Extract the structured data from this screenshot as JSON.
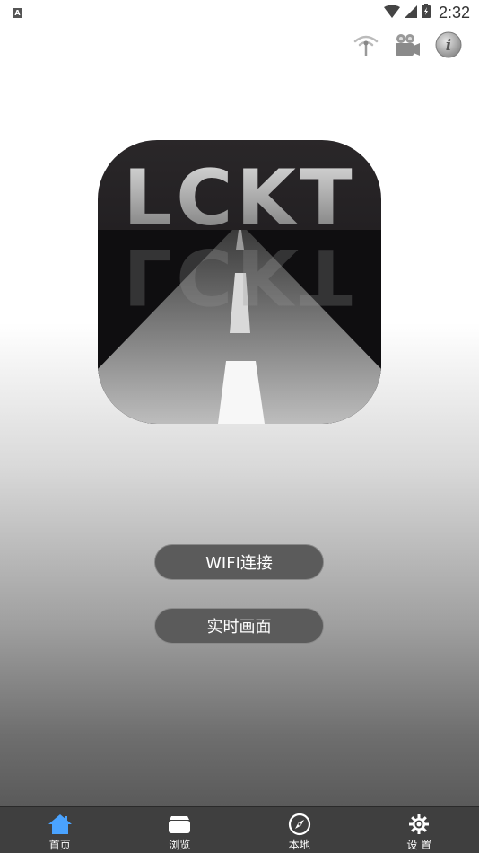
{
  "status_bar": {
    "indicator": "A",
    "time": "2:32",
    "icons": [
      "wifi-signal-icon",
      "cell-signal-icon",
      "battery-icon"
    ]
  },
  "top_actions": [
    {
      "icon": "wifi-antenna-icon"
    },
    {
      "icon": "video-camera-icon"
    },
    {
      "icon": "info-icon"
    }
  ],
  "logo": {
    "text": "LCKT"
  },
  "buttons": {
    "wifi_connect": "WIFI连接",
    "live_view": "实时画面"
  },
  "tabs": [
    {
      "label": "首页",
      "icon": "home-icon",
      "active": true
    },
    {
      "label": "浏览",
      "icon": "folder-icon",
      "active": false
    },
    {
      "label": "本地",
      "icon": "compass-icon",
      "active": false
    },
    {
      "label": "设 置",
      "icon": "gear-icon",
      "active": false
    }
  ],
  "colors": {
    "active_tab": "#4aa3ff",
    "tab_bar": "#3f3f3f",
    "button": "#5b5b5b"
  }
}
